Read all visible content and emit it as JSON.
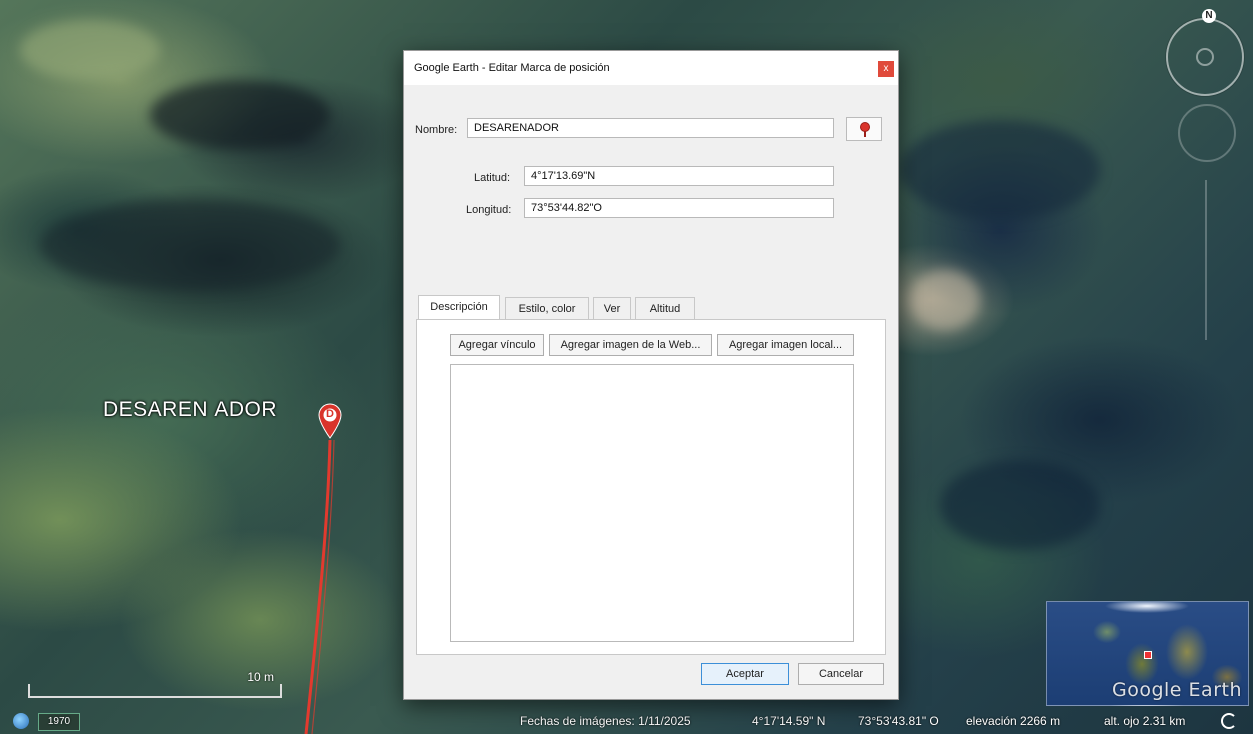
{
  "map": {
    "placemark_label": "DESAREN ADOR",
    "pin_letter": "D",
    "scale_label": "10 m"
  },
  "navigation": {
    "north_label": "N"
  },
  "overview": {
    "logo": "Google Earth"
  },
  "statusbar": {
    "year": "1970",
    "imagery_date": "Fechas de imágenes: 1/11/2025",
    "latitude": "4°17'14.59\" N",
    "longitude": "73°53'43.81\" O",
    "elevation": "elevación 2266 m",
    "eye_altitude": "alt. ojo  2.31 km"
  },
  "dialog": {
    "title": "Google Earth - Editar Marca de posición",
    "close_label": "x",
    "name_label": "Nombre:",
    "name_value": "DESARENADOR",
    "latitude_label": "Latitud:",
    "latitude_value": "4°17'13.69\"N",
    "longitude_label": "Longitud:",
    "longitude_value": "73°53'44.82\"O",
    "tabs": [
      {
        "label": "Descripción"
      },
      {
        "label": "Estilo, color"
      },
      {
        "label": "Ver"
      },
      {
        "label": "Altitud"
      }
    ],
    "add_link_label": "Agregar vínculo",
    "add_web_image_label": "Agregar imagen de la Web...",
    "add_local_image_label": "Agregar imagen local...",
    "ok_label": "Aceptar",
    "cancel_label": "Cancelar"
  },
  "colors": {
    "placemark_red": "#d9342b",
    "close_red": "#e04a3b",
    "dialog_bg": "#f0f0f0"
  }
}
